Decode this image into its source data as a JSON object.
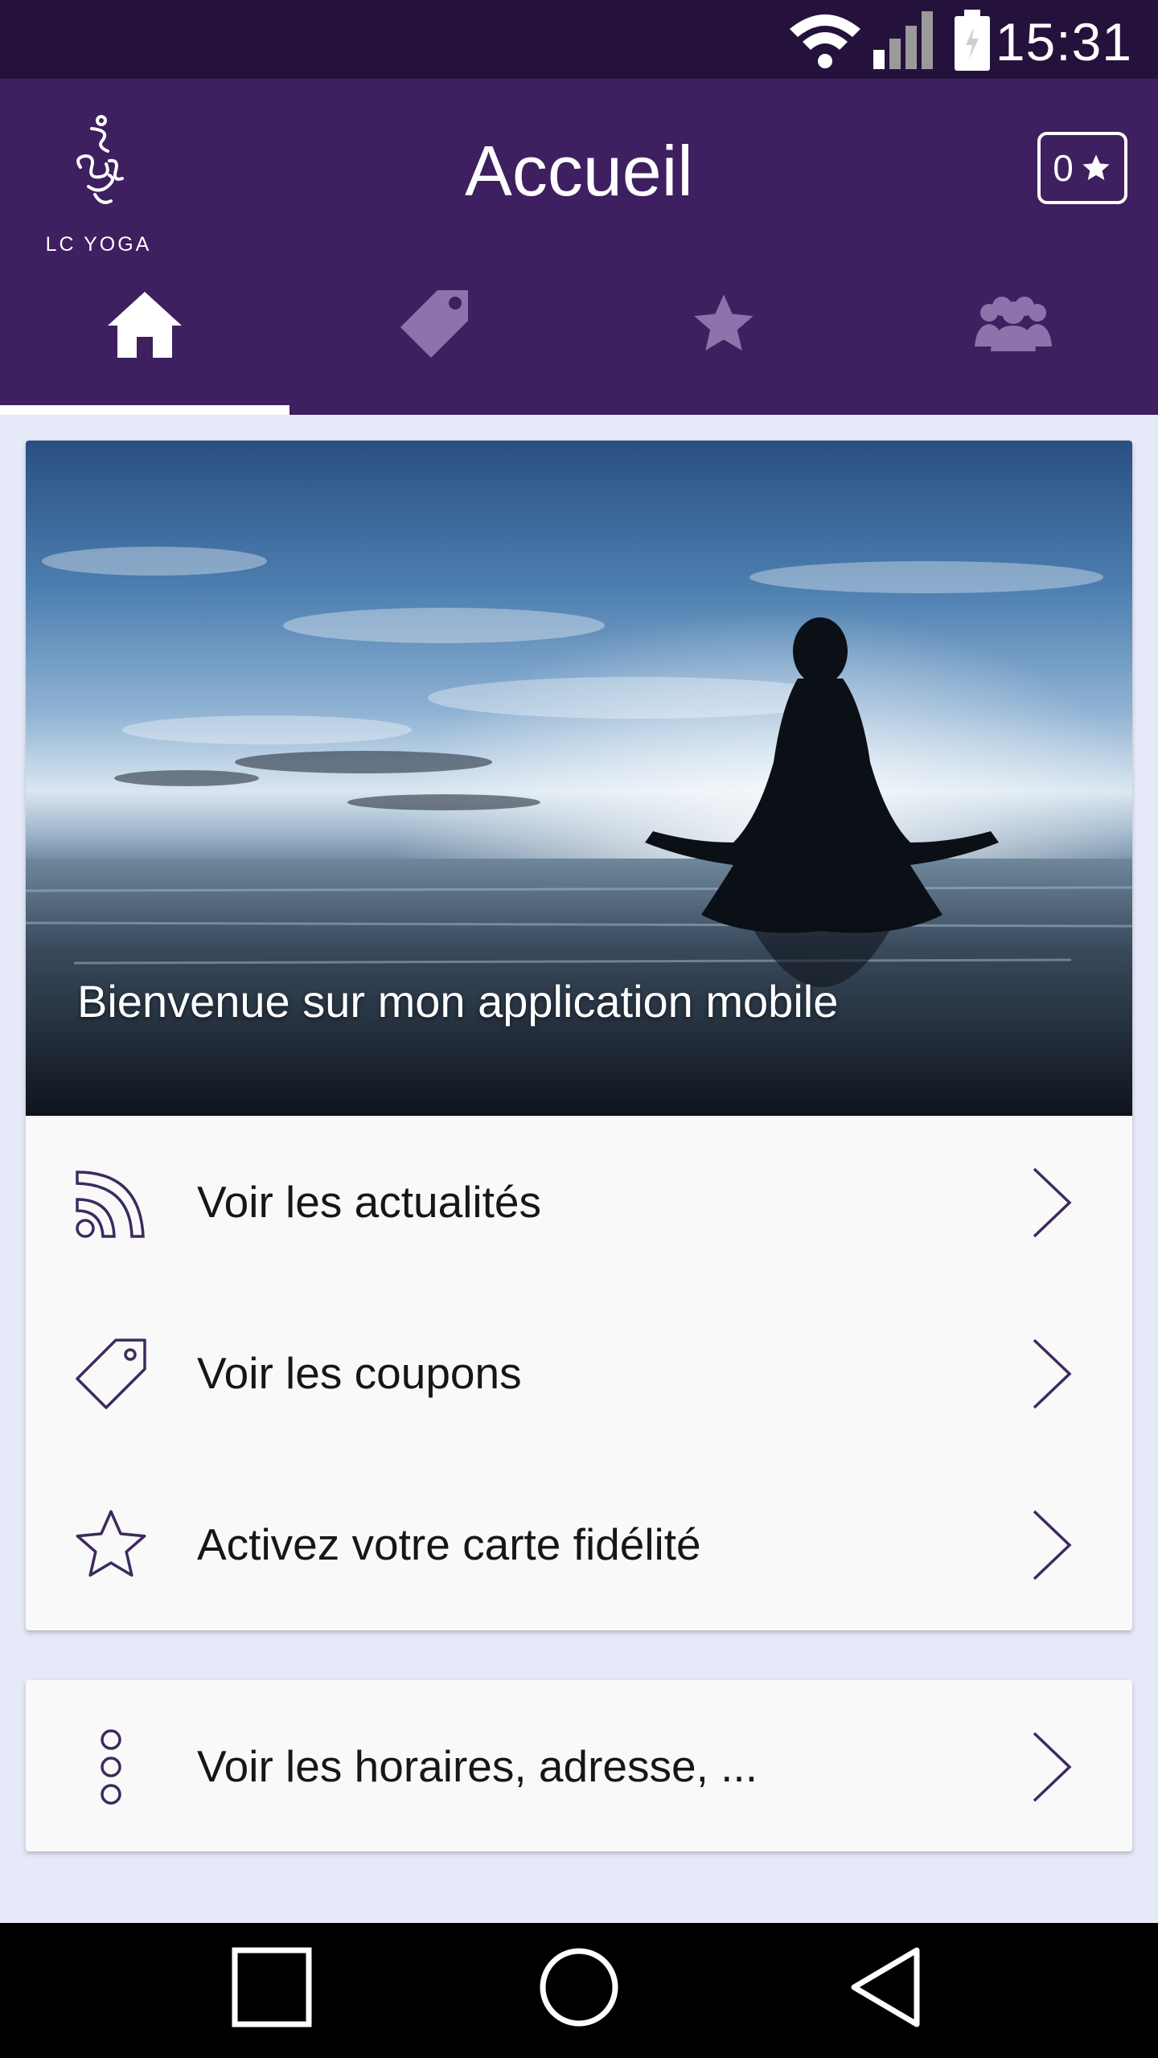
{
  "status_bar": {
    "time": "15:31"
  },
  "header": {
    "logo_text": "LC YOGA",
    "title": "Accueil",
    "points_count": "0"
  },
  "tabs": [
    {
      "name": "home",
      "icon": "home-icon",
      "active": true
    },
    {
      "name": "coupons",
      "icon": "tag-icon",
      "active": false
    },
    {
      "name": "loyalty",
      "icon": "star-icon",
      "active": false
    },
    {
      "name": "community",
      "icon": "group-icon",
      "active": false
    }
  ],
  "hero": {
    "caption": "Bienvenue sur mon application mobile"
  },
  "menu": [
    {
      "label": "Voir les actualités",
      "icon": "rss-icon"
    },
    {
      "label": "Voir les coupons",
      "icon": "tag-icon"
    },
    {
      "label": "Activez votre carte fidélité",
      "icon": "star-icon"
    }
  ],
  "info": {
    "label": "Voir les horaires, adresse, ...",
    "icon": "more-dots-icon"
  },
  "colors": {
    "status_bar": "#24123c",
    "app_bar": "#3e1f60",
    "tab_inactive": "#8f72ac",
    "accent_icon": "#3e2a5e",
    "background": "#e6e9f8"
  }
}
